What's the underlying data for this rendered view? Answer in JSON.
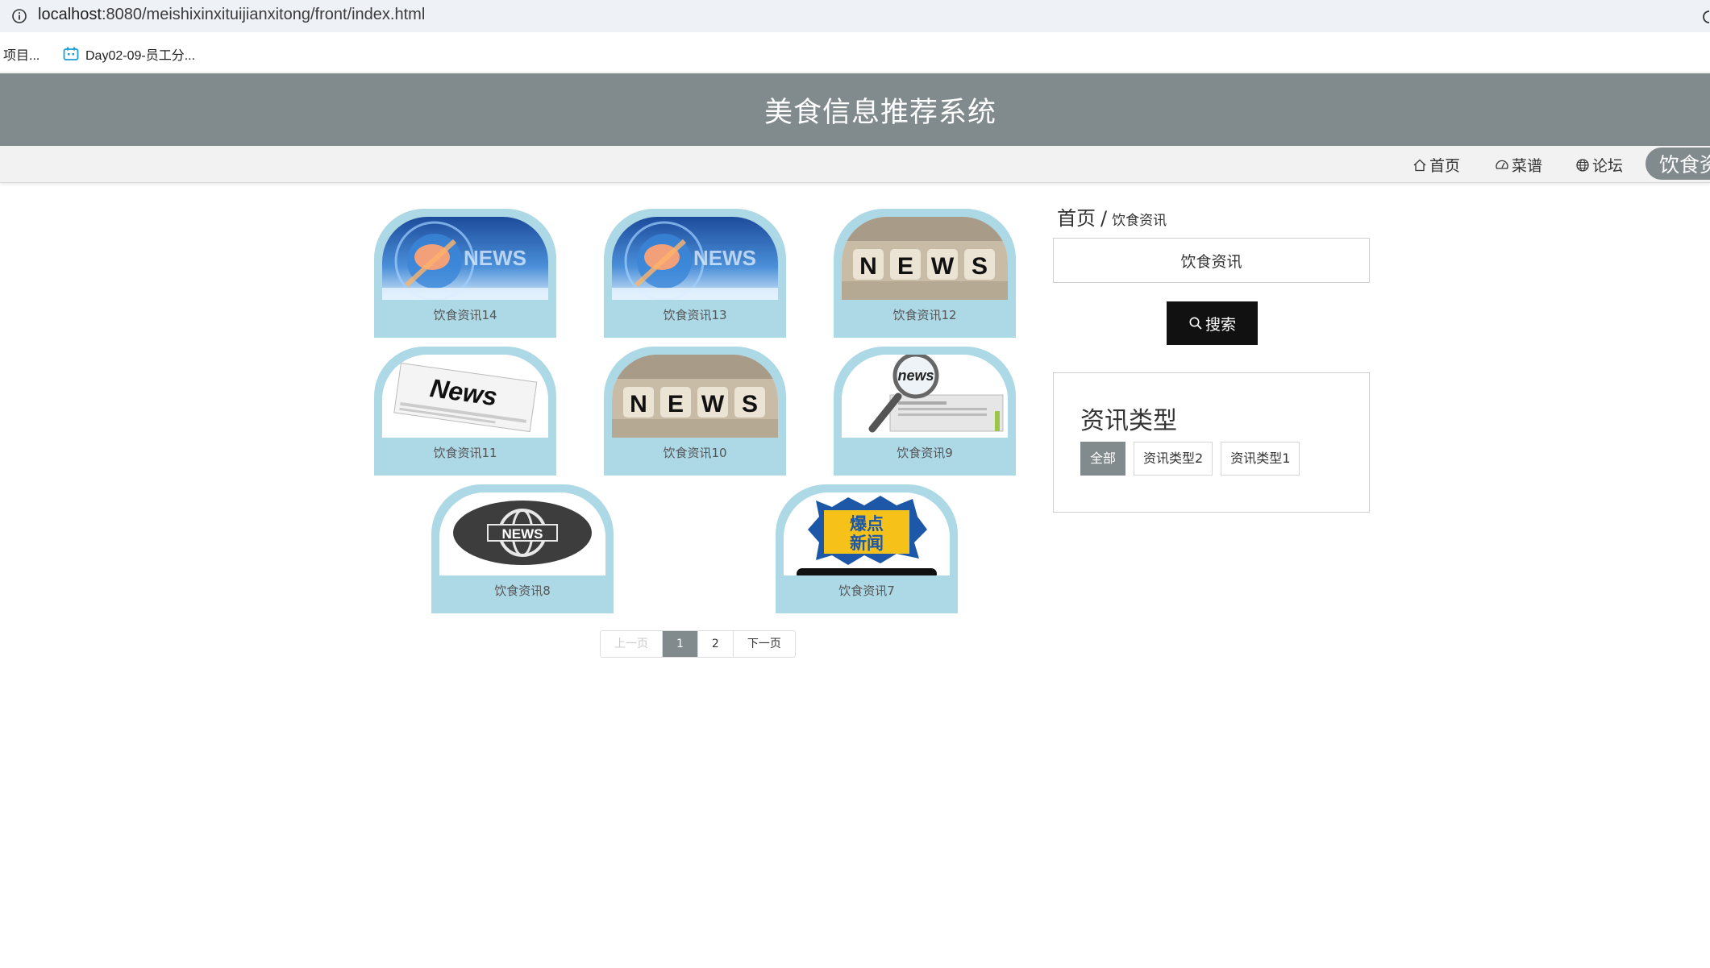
{
  "browser": {
    "url_host": "localhost",
    "url_path": ":8080/meishixinxituijianxitong/front/index.html",
    "bookmarks": [
      {
        "label": "项目..."
      },
      {
        "label": "Day02-09-员工分..."
      }
    ]
  },
  "site": {
    "title": "美食信息推荐系统"
  },
  "nav": {
    "home": "首页",
    "recipe": "菜谱",
    "forum": "论坛",
    "news": "饮食资"
  },
  "cards": [
    {
      "label": "饮食资讯14",
      "image": "news-globe-hand"
    },
    {
      "label": "饮食资讯13",
      "image": "news-globe-hand"
    },
    {
      "label": "饮食资讯12",
      "image": "news-dice-blocks"
    },
    {
      "label": "饮食资讯11",
      "image": "news-newspaper"
    },
    {
      "label": "饮食资讯10",
      "image": "news-dice-blocks"
    },
    {
      "label": "饮食资讯9",
      "image": "news-magnifier"
    },
    {
      "label": "饮食资讯8",
      "image": "news-globe-badge"
    },
    {
      "label": "饮食资讯7",
      "image": "breaking-news-phone"
    }
  ],
  "pagination": {
    "prev": "上一页",
    "pages": [
      "1",
      "2"
    ],
    "current": "1",
    "next": "下一页"
  },
  "sidebar": {
    "breadcrumb_home": "首页",
    "breadcrumb_sep": "/",
    "breadcrumb_current": "饮食资讯",
    "search_value": "饮食资讯",
    "search_button": "搜索",
    "type_title": "资讯类型",
    "types": [
      "全部",
      "资讯类型2",
      "资讯类型1"
    ],
    "active_type": "全部"
  },
  "image_text": {
    "news_en": "NEWS",
    "news_lower": "news",
    "news_title": "News",
    "letters": [
      "N",
      "E",
      "W",
      "S"
    ],
    "breaking_top": "爆点",
    "breaking_bottom": "新闻"
  },
  "colors": {
    "header_bg": "#818a8d",
    "card_bg": "#add8e6",
    "button_bg": "#111111"
  }
}
